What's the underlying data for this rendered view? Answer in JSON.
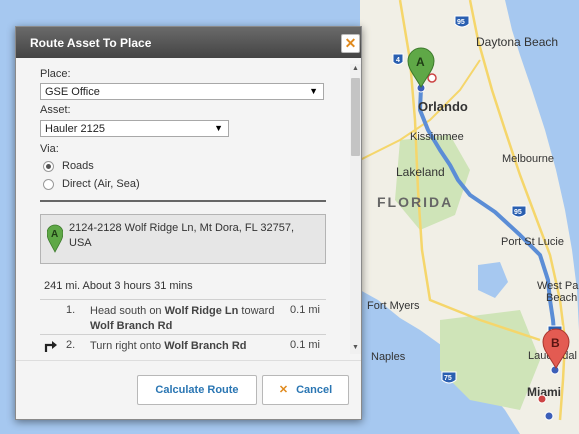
{
  "map": {
    "labels": {
      "daytona_beach": "Daytona Beach",
      "orlando": "Orlando",
      "kissimmee": "Kissimmee",
      "lakeland": "Lakeland",
      "melbourne": "Melbourne",
      "florida": "FLORIDA",
      "port_st_lucie": "Port St Lucie",
      "fort_myers": "Fort Myers",
      "west_palm": "West Pa",
      "beach": "Beach",
      "naples": "Naples",
      "lauderdale": "Lauderdal",
      "miami": "Miami"
    },
    "shields": {
      "i95_a": "95",
      "i95_b": "95",
      "i95_c": "95",
      "i4": "4",
      "i75": "75"
    },
    "markers": {
      "start": "A",
      "end": "B"
    },
    "colors": {
      "route": "#5b8dd6",
      "start_marker": "#5fa847",
      "end_marker": "#e35b52",
      "water": "#a6c8f0",
      "land": "#f1efe6"
    }
  },
  "dialog": {
    "title": "Route Asset To Place",
    "close_icon": "close-icon",
    "place_label": "Place:",
    "place_value": "GSE Office",
    "asset_label": "Asset:",
    "asset_value": "Hauler 2125",
    "via_label": "Via:",
    "via_options": [
      {
        "label": "Roads",
        "selected": true
      },
      {
        "label": "Direct (Air, Sea)",
        "selected": false
      }
    ],
    "start_marker_label": "A",
    "address": "2124-2128 Wolf Ridge Ln, Mt Dora, FL 32757, USA",
    "summary": "241 mi. About 3 hours 31 mins",
    "steps": [
      {
        "num": "1.",
        "text": "Head south on Wolf Ridge Ln toward Wolf Branch Rd",
        "text_parts": [
          "Head south on ",
          "Wolf Ridge Ln",
          " toward ",
          "Wolf Branch Rd"
        ],
        "dist": "0.1 mi",
        "icon": ""
      },
      {
        "num": "2.",
        "text": "Turn right onto Wolf Branch Rd",
        "text_parts": [
          "Turn right onto ",
          "Wolf Branch Rd"
        ],
        "dist": "0.1 mi",
        "icon": "turn-right-icon"
      }
    ],
    "calculate_label": "Calculate Route",
    "cancel_label": "Cancel"
  }
}
